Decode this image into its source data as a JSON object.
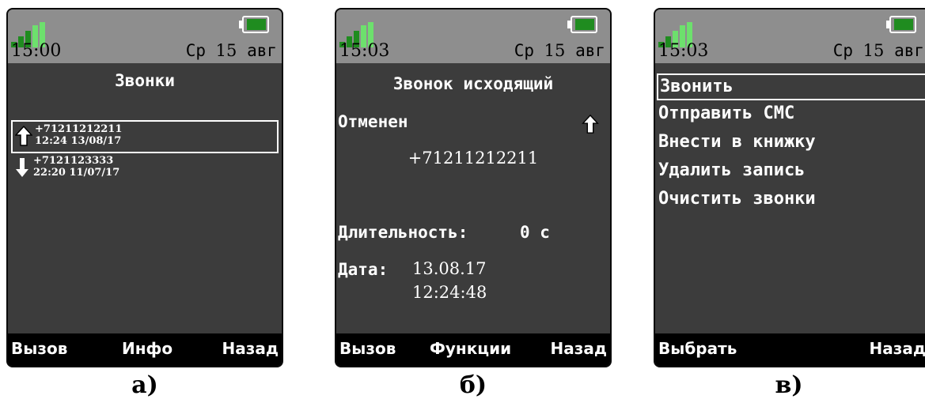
{
  "colors": {
    "phone_bg": "#3c3c3c",
    "status_bg": "#8e8e8e",
    "signal_green": "#1f8c1f",
    "signal_light": "#6de06d",
    "softbar_bg": "#000000"
  },
  "screens": [
    {
      "caption": "а)",
      "status": {
        "time": "15:00",
        "day": "Ср",
        "date_num": "15",
        "month": "авг"
      },
      "title": "Звонки",
      "calls": [
        {
          "direction": "outgoing",
          "number": "+71211212211",
          "timestamp": "12:24 13/08/17",
          "selected": true
        },
        {
          "direction": "incoming",
          "number": "+7121123333",
          "timestamp": "22:20 11/07/17",
          "selected": false
        }
      ],
      "softkeys": {
        "left": "Вызов",
        "center": "Инфо",
        "right": "Назад"
      }
    },
    {
      "caption": "б)",
      "status": {
        "time": "15:03",
        "day": "Ср",
        "date_num": "15",
        "month": "авг"
      },
      "title": "Звонок исходящий",
      "state": "Отменен",
      "number": "+71211212211",
      "duration_label": "Длительность:",
      "duration_value": "0 с",
      "date_label": "Дата:",
      "date_value": "13.08.17",
      "time_value": "12:24:48",
      "softkeys": {
        "left": "Вызов",
        "center": "Функции",
        "right": "Назад"
      }
    },
    {
      "caption": "в)",
      "status": {
        "time": "15:03",
        "day": "Ср",
        "date_num": "15",
        "month": "авг"
      },
      "menu": [
        "Звонить",
        "Отправить СМС",
        "Внести в книжку",
        "Удалить запись",
        "Очистить звонки"
      ],
      "selected_index": 0,
      "softkeys": {
        "left": "Выбрать",
        "center": "",
        "right": "Назад"
      }
    }
  ]
}
